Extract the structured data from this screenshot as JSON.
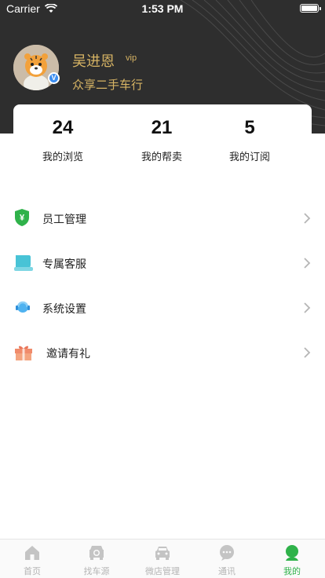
{
  "status_bar": {
    "carrier": "Carrier",
    "time": "1:53 PM"
  },
  "profile": {
    "name": "吴进恩",
    "badge": "vip",
    "company": "众享二手车行",
    "verified_mark": "V"
  },
  "stats": [
    {
      "value": "24",
      "label": "我的浏览"
    },
    {
      "value": "21",
      "label": "我的帮卖"
    },
    {
      "value": "5",
      "label": "我的订阅"
    }
  ],
  "menu": [
    {
      "label": "员工管理",
      "icon": "yuan-shield-icon"
    },
    {
      "label": "专属客服",
      "icon": "customer-service-icon"
    },
    {
      "label": "系统设置",
      "icon": "settings-bubble-icon"
    },
    {
      "label": "邀请有礼",
      "icon": "gift-icon"
    }
  ],
  "tabbar": [
    {
      "label": "首页",
      "icon": "home-icon",
      "active": false
    },
    {
      "label": "找车源",
      "icon": "car-search-icon",
      "active": false
    },
    {
      "label": "微店管理",
      "icon": "car-store-icon",
      "active": false
    },
    {
      "label": "通讯",
      "icon": "chat-icon",
      "active": false
    },
    {
      "label": "我的",
      "icon": "user-icon",
      "active": true
    }
  ],
  "colors": {
    "header_bg": "#2e2e2e",
    "gold": "#d7b464",
    "active_green": "#2fb24a",
    "inactive_gray": "#b4b4b4"
  }
}
